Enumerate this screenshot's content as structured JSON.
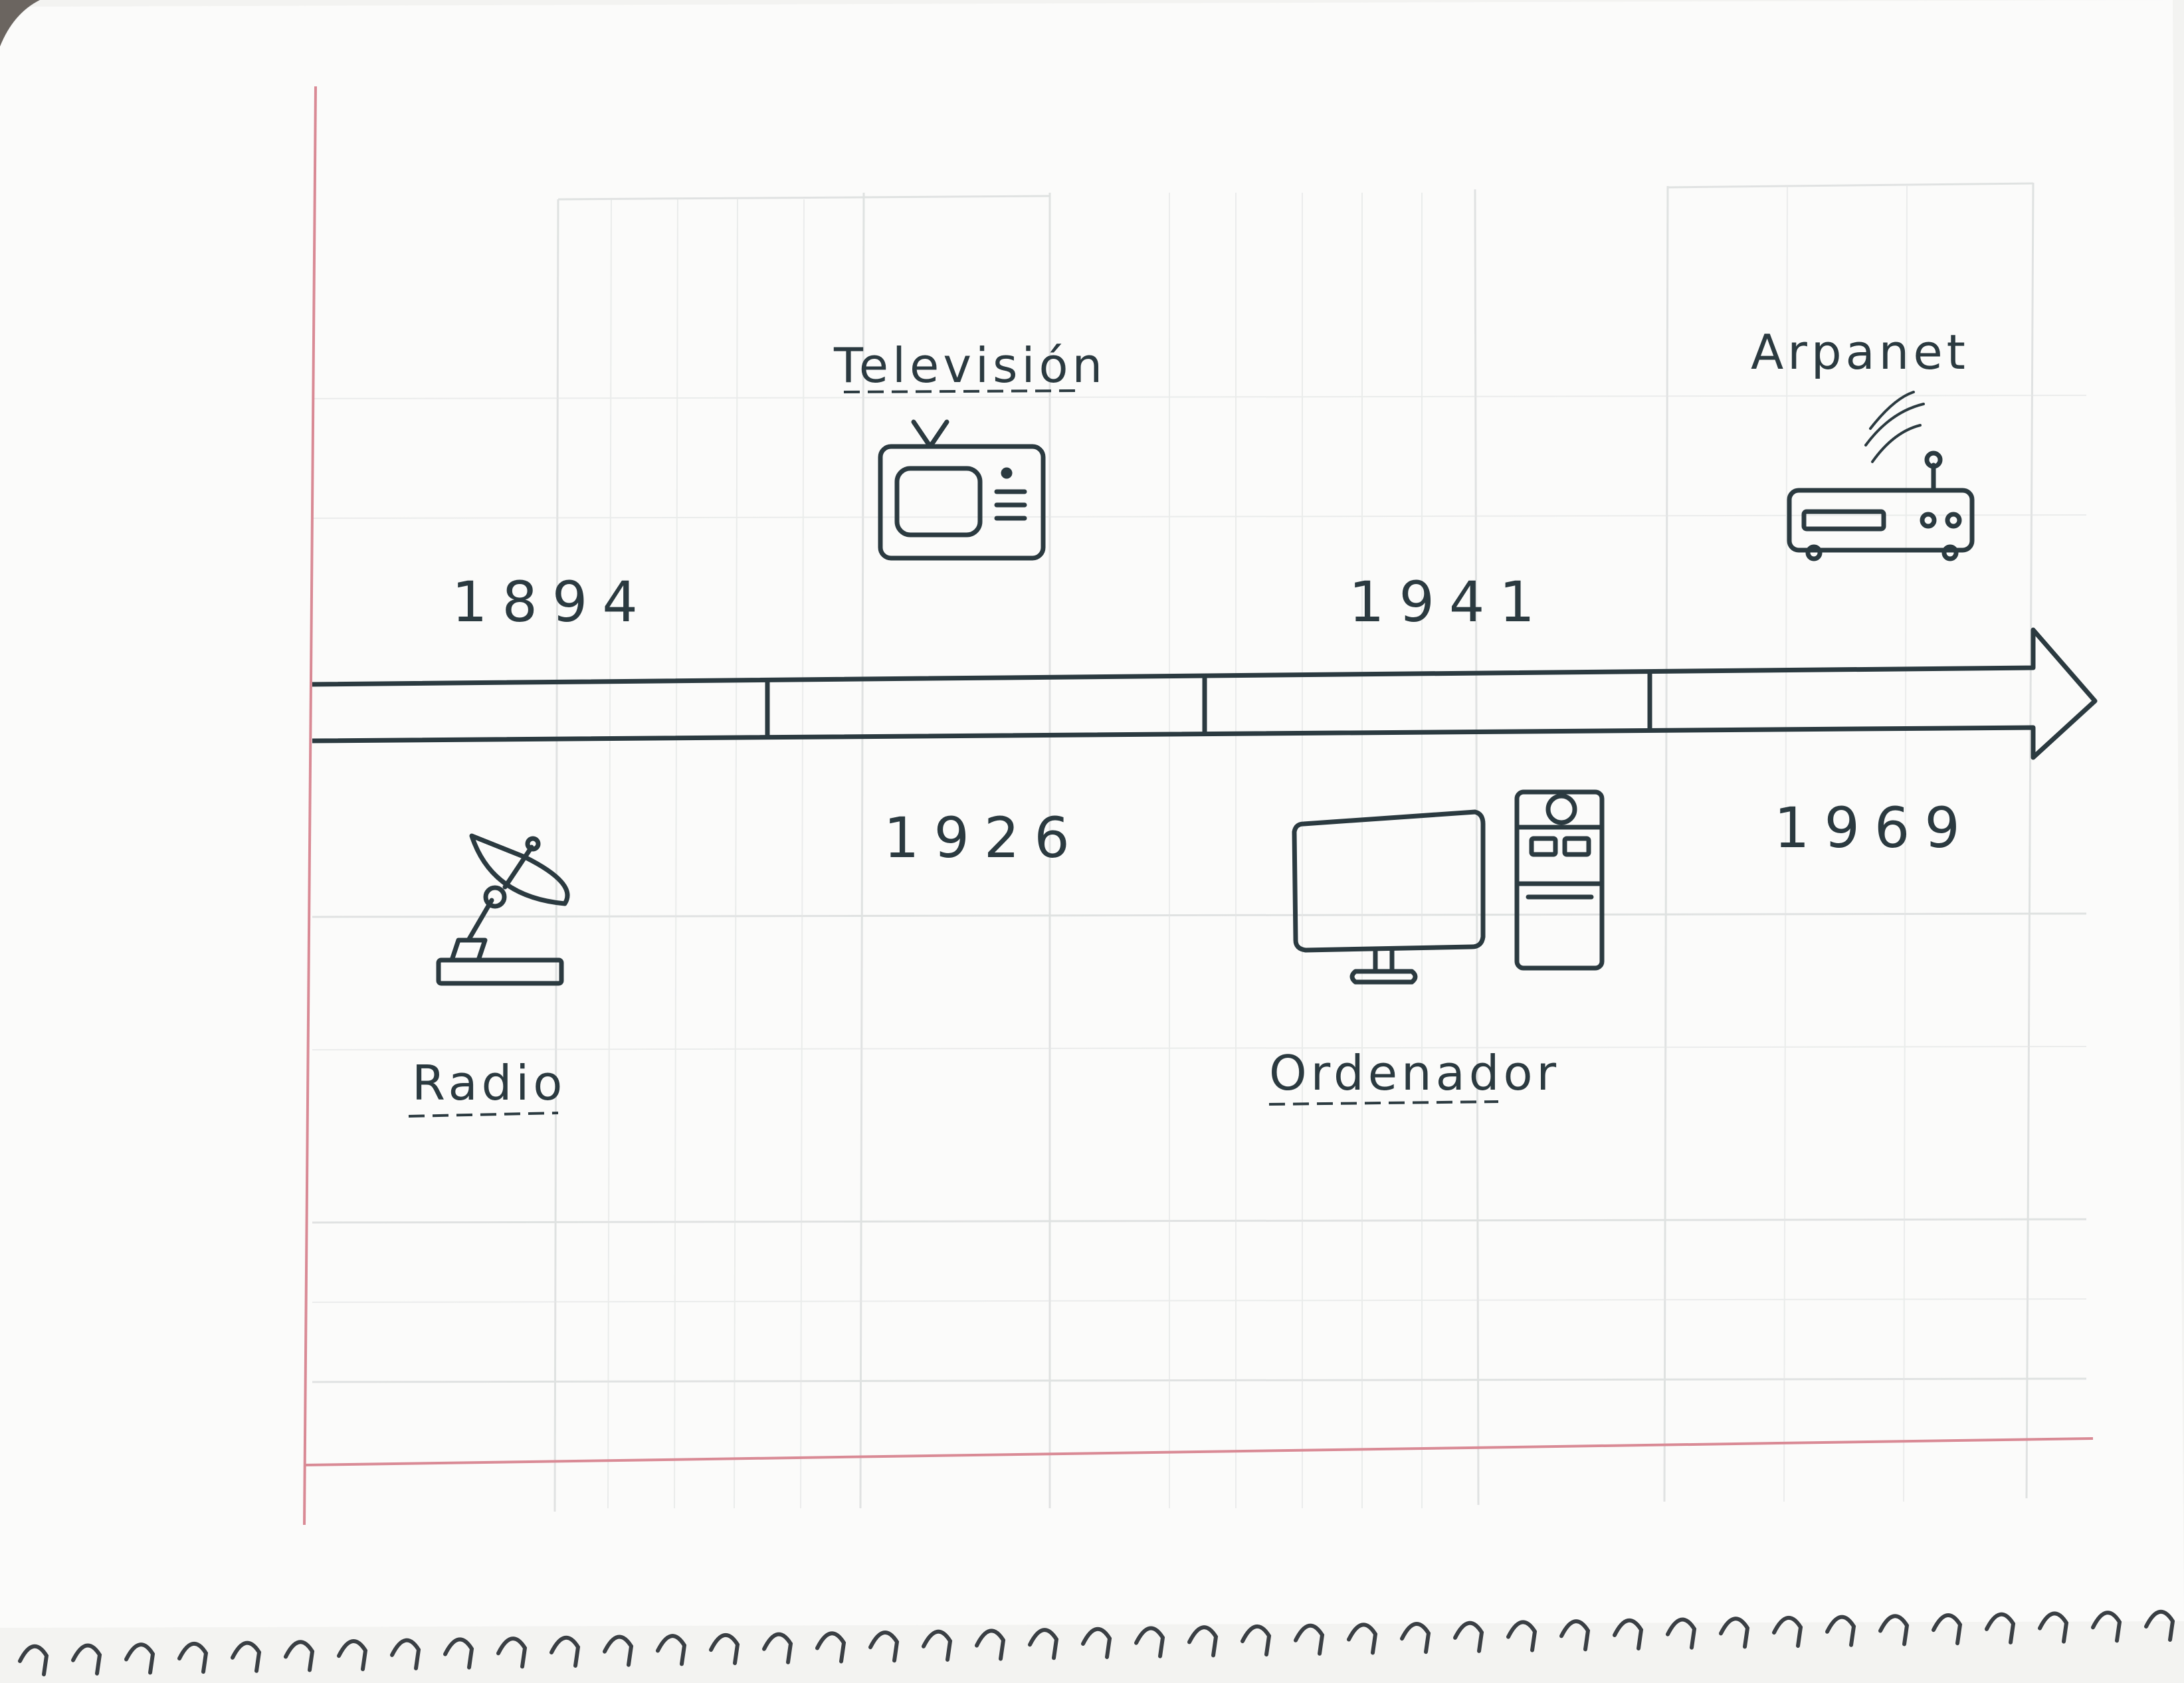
{
  "events": [
    {
      "year": "1894",
      "label": "Radio",
      "icon": "satellite-dish-icon",
      "year_side": "top",
      "label_side": "bottom"
    },
    {
      "year": "1926",
      "label": "Televisión",
      "icon": "television-icon",
      "year_side": "bottom",
      "label_side": "top"
    },
    {
      "year": "1941",
      "label": "Ordenador",
      "icon": "desktop-computer-icon",
      "year_side": "top",
      "label_side": "bottom"
    },
    {
      "year": "1969",
      "label": "Arpanet",
      "icon": "router-icon",
      "year_side": "bottom",
      "label_side": "top"
    }
  ],
  "colors": {
    "ink": "#2b3a40",
    "paper": "#fbfbfa",
    "grid": "#d9dcdc",
    "margin": "#d98a95",
    "spiral": "#3a3f44"
  }
}
